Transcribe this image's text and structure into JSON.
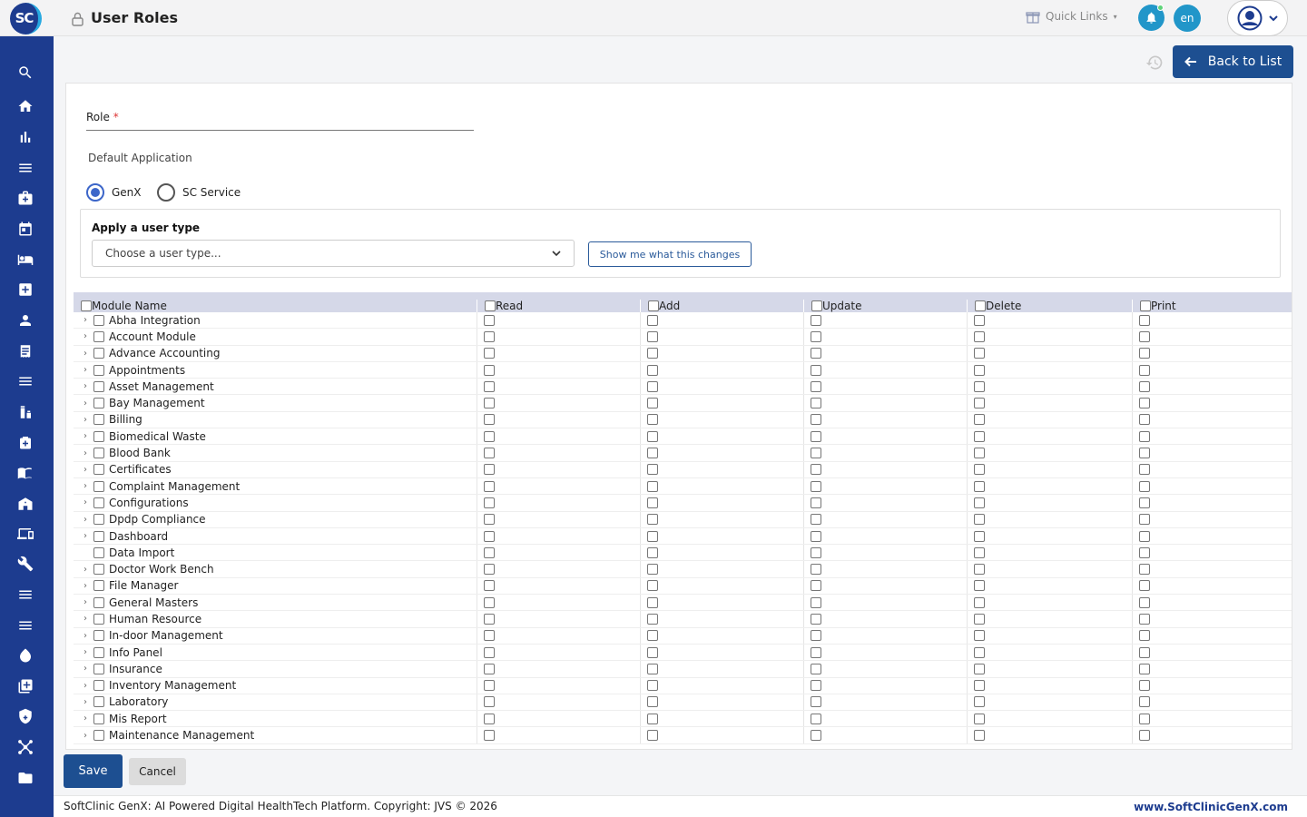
{
  "header": {
    "logo_text": "SC",
    "title": "User Roles",
    "quick_links": "Quick Links",
    "language": "en"
  },
  "actions": {
    "back_to_list": "Back to List"
  },
  "form": {
    "role_label": "Role",
    "role_required": "*",
    "role_value": "",
    "default_application_label": "Default Application",
    "options": [
      {
        "label": "GenX",
        "selected": true
      },
      {
        "label": "SC Service",
        "selected": false
      }
    ],
    "user_type_title": "Apply a user type",
    "user_type_placeholder": "Choose a user type...",
    "show_changes": "Show me what this changes"
  },
  "table": {
    "headers": [
      "Module Name",
      "Read",
      "Add",
      "Update",
      "Delete",
      "Print"
    ],
    "rows": [
      {
        "name": "Abha Integration",
        "expandable": true
      },
      {
        "name": "Account Module",
        "expandable": true
      },
      {
        "name": "Advance Accounting",
        "expandable": true
      },
      {
        "name": "Appointments",
        "expandable": true
      },
      {
        "name": "Asset Management",
        "expandable": true
      },
      {
        "name": "Bay Management",
        "expandable": true
      },
      {
        "name": "Billing",
        "expandable": true
      },
      {
        "name": "Biomedical Waste",
        "expandable": true
      },
      {
        "name": "Blood Bank",
        "expandable": true
      },
      {
        "name": "Certificates",
        "expandable": true
      },
      {
        "name": "Complaint Management",
        "expandable": true
      },
      {
        "name": "Configurations",
        "expandable": true
      },
      {
        "name": "Dpdp Compliance",
        "expandable": true
      },
      {
        "name": "Dashboard",
        "expandable": true
      },
      {
        "name": "Data Import",
        "expandable": false
      },
      {
        "name": "Doctor Work Bench",
        "expandable": true
      },
      {
        "name": "File Manager",
        "expandable": true
      },
      {
        "name": "General Masters",
        "expandable": true
      },
      {
        "name": "Human Resource",
        "expandable": true
      },
      {
        "name": "In-door Management",
        "expandable": true
      },
      {
        "name": "Info Panel",
        "expandable": true
      },
      {
        "name": "Insurance",
        "expandable": true
      },
      {
        "name": "Inventory Management",
        "expandable": true
      },
      {
        "name": "Laboratory",
        "expandable": true
      },
      {
        "name": "Mis Report",
        "expandable": true
      },
      {
        "name": "Maintenance Management",
        "expandable": true
      }
    ]
  },
  "buttons": {
    "save": "Save",
    "cancel": "Cancel"
  },
  "footer": {
    "text": "SoftClinic GenX: AI Powered Digital HealthTech Platform. Copyright: JVS © 2026",
    "link": "www.SoftClinicGenX.com"
  },
  "sidebar": {
    "icons": [
      "search-icon",
      "home-icon",
      "bar-chart-icon",
      "menu-icon",
      "medical-bag-icon",
      "calendar-icon",
      "bed-icon",
      "medical-plus-icon",
      "user-icon",
      "receipt-icon",
      "list-icon",
      "medication-icon",
      "pharmacy-icon",
      "book-icon",
      "hospital-icon",
      "devices-icon",
      "wrench-icon",
      "list-icon",
      "list-icon",
      "water-drop-icon",
      "add-box-icon",
      "shield-icon",
      "network-icon",
      "folder-icon"
    ]
  },
  "colors": {
    "brand": "#1d3c8f",
    "accent": "#2196c9",
    "primary_button": "#1d4f91"
  }
}
